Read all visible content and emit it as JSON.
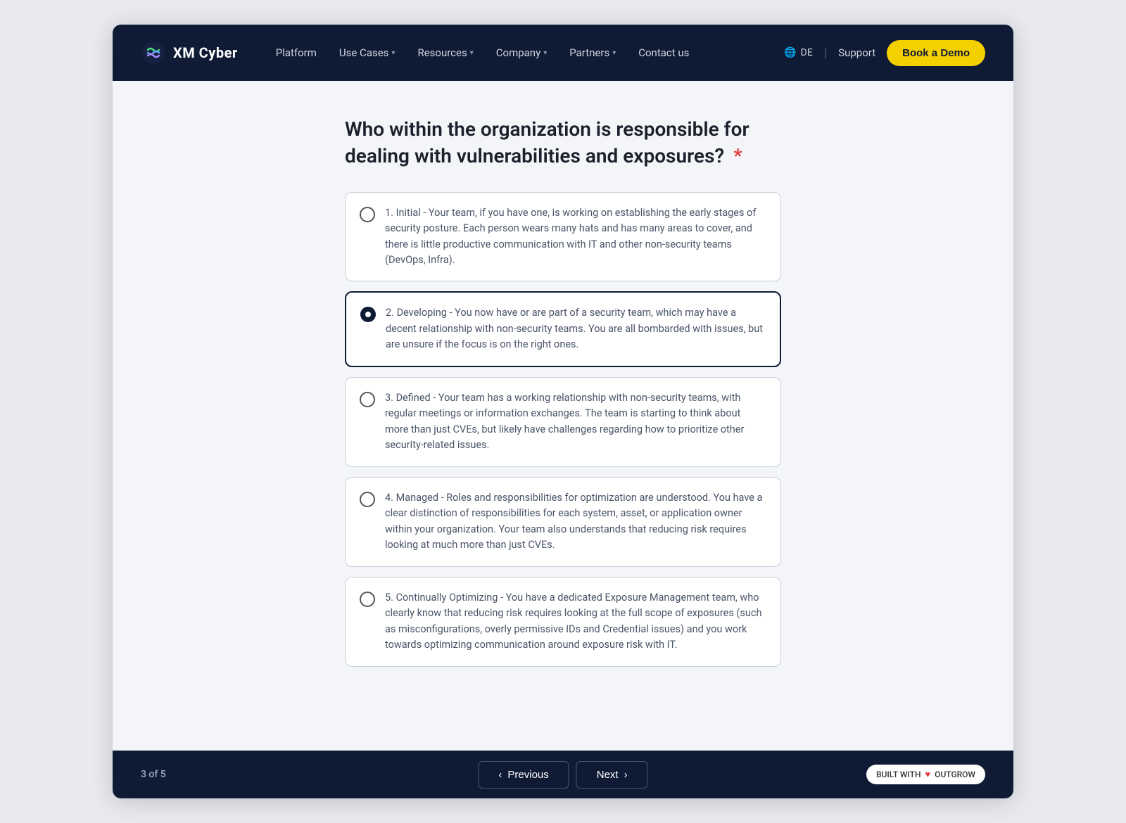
{
  "navbar": {
    "logo_text": "XM Cyber",
    "nav_items": [
      {
        "label": "Platform",
        "has_dropdown": false
      },
      {
        "label": "Use Cases",
        "has_dropdown": true
      },
      {
        "label": "Resources",
        "has_dropdown": true
      },
      {
        "label": "Company",
        "has_dropdown": true
      },
      {
        "label": "Partners",
        "has_dropdown": true
      },
      {
        "label": "Contact us",
        "has_dropdown": false
      }
    ],
    "lang": "DE",
    "support": "Support",
    "book_demo": "Book a Demo"
  },
  "question": {
    "text": "Who within the organization is responsible for dealing with vulnerabilities and exposures?",
    "required": "*"
  },
  "options": [
    {
      "id": 1,
      "selected": false,
      "label": "1. Initial - Your team, if you have one, is working on establishing the early stages of security posture. Each person wears many hats and has many areas to cover, and there is little productive communication with IT and other non-security teams (DevOps, Infra)."
    },
    {
      "id": 2,
      "selected": true,
      "label": "2. Developing - You now have or are part of a security team, which may have a decent relationship with non-security teams. You are all bombarded with issues, but are unsure if the focus is on the right ones."
    },
    {
      "id": 3,
      "selected": false,
      "label": "3. Defined - Your team has a working relationship with non-security teams, with regular meetings or information exchanges. The team is starting to think about more than just CVEs, but likely have challenges regarding how to prioritize other security-related issues."
    },
    {
      "id": 4,
      "selected": false,
      "label": "4. Managed - Roles and responsibilities for optimization are understood. You have a clear distinction of responsibilities for each system, asset, or application owner within your organization. Your team also understands that reducing risk requires looking at much more than just CVEs."
    },
    {
      "id": 5,
      "selected": false,
      "label": "5. Continually Optimizing - You have a dedicated Exposure Management team, who clearly know that reducing risk requires looking at the full scope of exposures (such as misconfigurations, overly permissive IDs and Credential issues) and you work towards optimizing communication around exposure risk with IT."
    }
  ],
  "footer": {
    "page_indicator": "3 of 5",
    "previous_label": "Previous",
    "next_label": "Next",
    "built_with_label": "BUILT WITH",
    "built_with_brand": "OUTGROW"
  }
}
